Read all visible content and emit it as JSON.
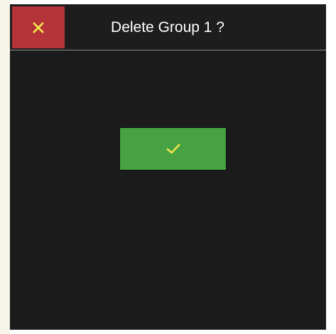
{
  "dialog": {
    "title": "Delete Group 1 ?",
    "close_icon": "close-icon",
    "confirm_icon": "checkmark-icon"
  },
  "colors": {
    "background": "#1b1b1b",
    "close_button": "#b5343a",
    "close_icon": "#f5e84a",
    "confirm_button": "#46a243",
    "confirm_icon": "#f5e84a",
    "title_text": "#ffffff"
  }
}
